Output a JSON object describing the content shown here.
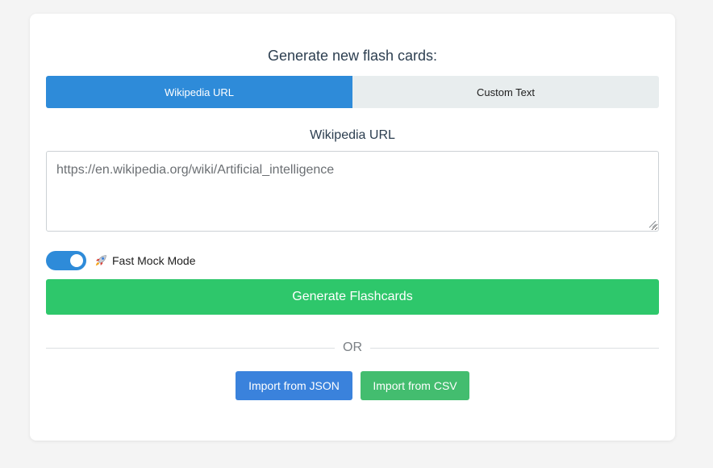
{
  "heading": "Generate new flash cards:",
  "tabs": [
    {
      "label": "Wikipedia URL",
      "active": true
    },
    {
      "label": "Custom Text",
      "active": false
    }
  ],
  "url_field": {
    "label": "Wikipedia URL",
    "value": "https://en.wikipedia.org/wiki/Artificial_intelligence"
  },
  "mock_mode": {
    "label": "Fast Mock Mode",
    "icon": "rocket-icon",
    "enabled": true
  },
  "generate_label": "Generate Flashcards",
  "divider_text": "OR",
  "import": {
    "json_label": "Import from JSON",
    "csv_label": "Import from CSV"
  },
  "colors": {
    "primary": "#2e8bd9",
    "success": "#2ec76b",
    "tab_inactive": "#e8edee"
  }
}
